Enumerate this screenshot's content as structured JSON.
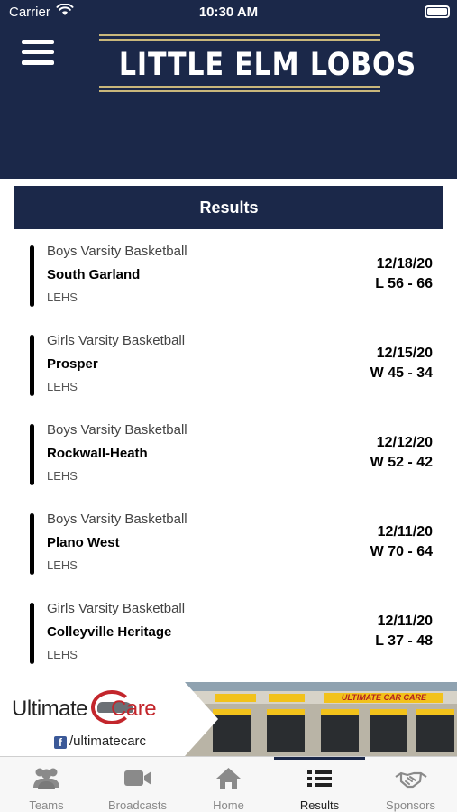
{
  "status_bar": {
    "carrier": "Carrier",
    "time": "10:30 AM"
  },
  "header": {
    "logo_text": "LITTLE ELM LOBOS",
    "menu_icon": "hamburger-menu-icon"
  },
  "results": {
    "title": "Results",
    "games": [
      {
        "sport": "Boys Varsity Basketball",
        "opponent": "South Garland",
        "school": "LEHS",
        "date": "12/18/20",
        "score": "L 56 - 66"
      },
      {
        "sport": "Girls Varsity Basketball",
        "opponent": "Prosper",
        "school": "LEHS",
        "date": "12/15/20",
        "score": "W 45 - 34"
      },
      {
        "sport": "Boys Varsity Basketball",
        "opponent": "Rockwall-Heath",
        "school": "LEHS",
        "date": "12/12/20",
        "score": "W 52 - 42"
      },
      {
        "sport": "Boys Varsity Basketball",
        "opponent": "Plano West",
        "school": "LEHS",
        "date": "12/11/20",
        "score": "W 70 - 64"
      },
      {
        "sport": "Girls Varsity Basketball",
        "opponent": "Colleyville Heritage",
        "school": "LEHS",
        "date": "12/11/20",
        "score": "L 37 - 48"
      }
    ]
  },
  "sponsor_ad": {
    "brand_left": "Ultimate",
    "brand_right": "Care",
    "social_handle": "/ultimatecarc",
    "sign_text": "ULTIMATE CAR CARE"
  },
  "tab_bar": {
    "active": "Results",
    "tabs": [
      {
        "label": "Teams",
        "icon": "teams-icon"
      },
      {
        "label": "Broadcasts",
        "icon": "video-camera-icon"
      },
      {
        "label": "Home",
        "icon": "home-icon"
      },
      {
        "label": "Results",
        "icon": "list-icon"
      },
      {
        "label": "Sponsors",
        "icon": "handshake-icon"
      }
    ]
  },
  "colors": {
    "navy": "#1b2849",
    "gold": "#c9b77b",
    "brand_red": "#c3262c"
  }
}
